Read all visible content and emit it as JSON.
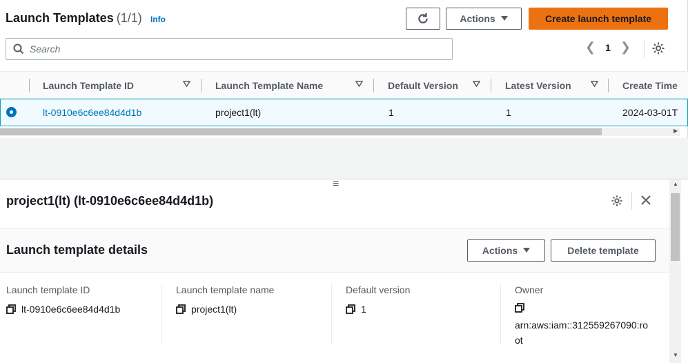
{
  "header": {
    "title": "Launch Templates",
    "count": "(1/1)",
    "info": "Info",
    "refresh_icon": "refresh-icon",
    "actions_label": "Actions",
    "create_label": "Create launch template"
  },
  "search": {
    "placeholder": "Search"
  },
  "pagination": {
    "page": "1",
    "prev_icon": "chevron-left-icon",
    "next_icon": "chevron-right-icon"
  },
  "table": {
    "columns": [
      "Launch Template ID",
      "Launch Template Name",
      "Default Version",
      "Latest Version",
      "Create Time"
    ],
    "rows": [
      {
        "selected": true,
        "id": "lt-0910e6c6ee84d4d1b",
        "name": "project1(lt)",
        "default_version": "1",
        "latest_version": "1",
        "create_time": "2024-03-01T"
      }
    ]
  },
  "panel": {
    "title": "project1(lt) (lt-0910e6c6ee84d4d1b)",
    "details_title": "Launch template details",
    "actions_label": "Actions",
    "delete_label": "Delete template",
    "fields": [
      {
        "label": "Launch template ID",
        "value": "lt-0910e6c6ee84d4d1b"
      },
      {
        "label": "Launch template name",
        "value": "project1(lt)"
      },
      {
        "label": "Default version",
        "value": "1"
      },
      {
        "label": "Owner",
        "value_line1": "arn:aws:iam::312559267090:ro",
        "value_line2": "ot"
      }
    ]
  },
  "colors": {
    "accent": "#ec7211",
    "link": "#0073bb",
    "selected_row": "#f1faff"
  }
}
